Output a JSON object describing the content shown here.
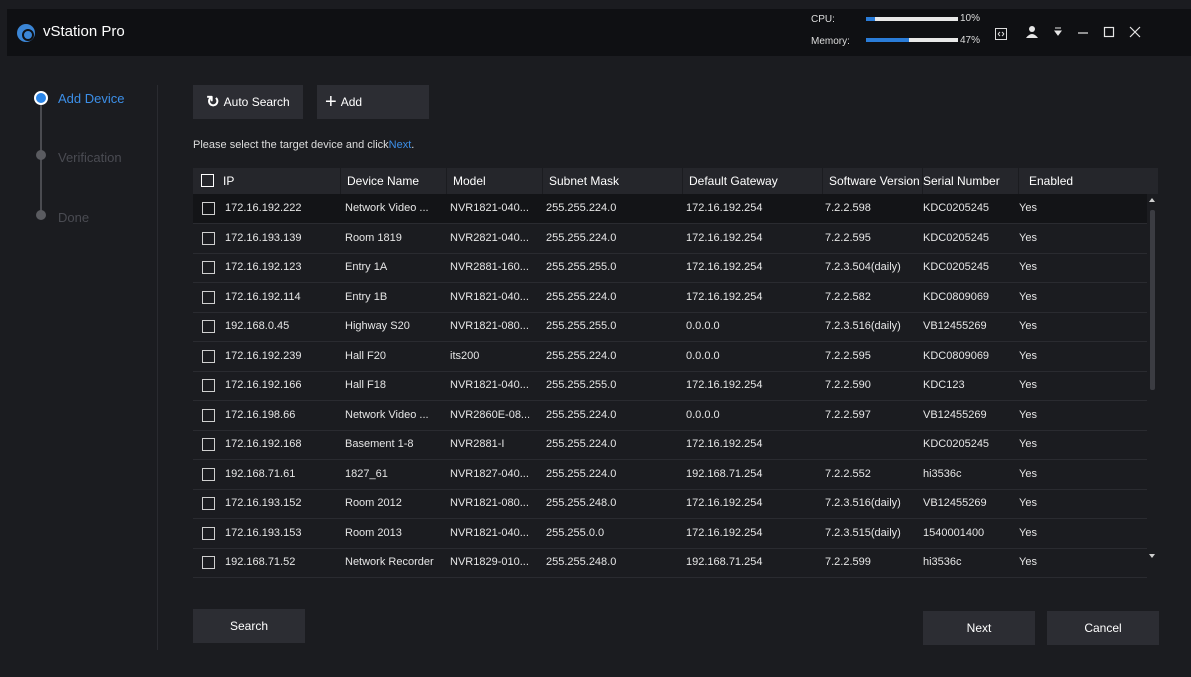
{
  "app": {
    "title": "vStation Pro"
  },
  "resources": {
    "cpu": {
      "label": "CPU:",
      "value": "10%",
      "fill": 0.1
    },
    "memory": {
      "label": "Memory:",
      "value": "47%",
      "fill": 0.47
    }
  },
  "titlebar_icons": [
    "screen-icon",
    "user-icon",
    "dropdown-icon",
    "minimize-icon",
    "maximize-icon",
    "close-icon"
  ],
  "steps": [
    {
      "label": "Add Device",
      "active": true
    },
    {
      "label": "Verification",
      "active": false
    },
    {
      "label": "Done",
      "active": false
    }
  ],
  "toolbar": {
    "auto_search": "Auto Search",
    "add": "Add"
  },
  "hint": {
    "text": "Please select the target device and click",
    "link": "Next",
    "end": "."
  },
  "table": {
    "headers": [
      "IP",
      "Device Name",
      "Model",
      "Subnet Mask",
      "Default Gateway",
      "Software Version",
      "Serial Number",
      "Enabled"
    ],
    "rows": [
      [
        "172.16.192.222",
        "Network Video ...",
        "NVR1821-040...",
        "255.255.224.0",
        "172.16.192.254",
        "7.2.2.598",
        "KDC0205245",
        "Yes"
      ],
      [
        "172.16.193.139",
        "Room 1819",
        "NVR2821-040...",
        "255.255.224.0",
        "172.16.192.254",
        "7.2.2.595",
        "KDC0205245",
        "Yes"
      ],
      [
        "172.16.192.123",
        "Entry 1A",
        "NVR2881-160...",
        "255.255.255.0",
        "172.16.192.254",
        "7.2.3.504(daily)",
        "KDC0205245",
        "Yes"
      ],
      [
        "172.16.192.114",
        "Entry 1B",
        "NVR1821-040...",
        "255.255.224.0",
        "172.16.192.254",
        "7.2.2.582",
        "KDC0809069",
        "Yes"
      ],
      [
        "192.168.0.45",
        "Highway S20",
        "NVR1821-080...",
        "255.255.255.0",
        "0.0.0.0",
        "7.2.3.516(daily)",
        "VB12455269",
        "Yes"
      ],
      [
        "172.16.192.239",
        "Hall F20",
        "its200",
        "255.255.224.0",
        "0.0.0.0",
        "7.2.2.595",
        "KDC0809069",
        "Yes"
      ],
      [
        "172.16.192.166",
        "Hall F18",
        "NVR1821-040...",
        "255.255.255.0",
        "172.16.192.254",
        "7.2.2.590",
        "KDC123",
        "Yes"
      ],
      [
        "172.16.198.66",
        "Network Video ...",
        "NVR2860E-08...",
        "255.255.224.0",
        "0.0.0.0",
        "7.2.2.597",
        "VB12455269",
        "Yes"
      ],
      [
        "172.16.192.168",
        "Basement 1-8",
        "NVR2881-I",
        "255.255.224.0",
        "172.16.192.254",
        "",
        "KDC0205245",
        "Yes"
      ],
      [
        "192.168.71.61",
        "1827_61",
        "NVR1827-040...",
        "255.255.224.0",
        "192.168.71.254",
        "7.2.2.552",
        "hi3536c",
        "Yes"
      ],
      [
        "172.16.193.152",
        "Room 2012",
        "NVR1821-080...",
        "255.255.248.0",
        "172.16.192.254",
        "7.2.3.516(daily)",
        "VB12455269",
        "Yes"
      ],
      [
        "172.16.193.153",
        "Room 2013",
        "NVR1821-040...",
        "255.255.0.0",
        "172.16.192.254",
        "7.2.3.515(daily)",
        "1540001400",
        "Yes"
      ],
      [
        "192.168.71.52",
        "Network Recorder",
        "NVR1829-010...",
        "255.255.248.0",
        "192.168.71.254",
        "7.2.2.599",
        "hi3536c",
        "Yes"
      ]
    ]
  },
  "footer": {
    "search": "Search",
    "next": "Next",
    "cancel": "Cancel"
  },
  "colors": {
    "accent": "#2a85e8",
    "background": "#1b1c20",
    "titlebar": "#0f1013"
  }
}
